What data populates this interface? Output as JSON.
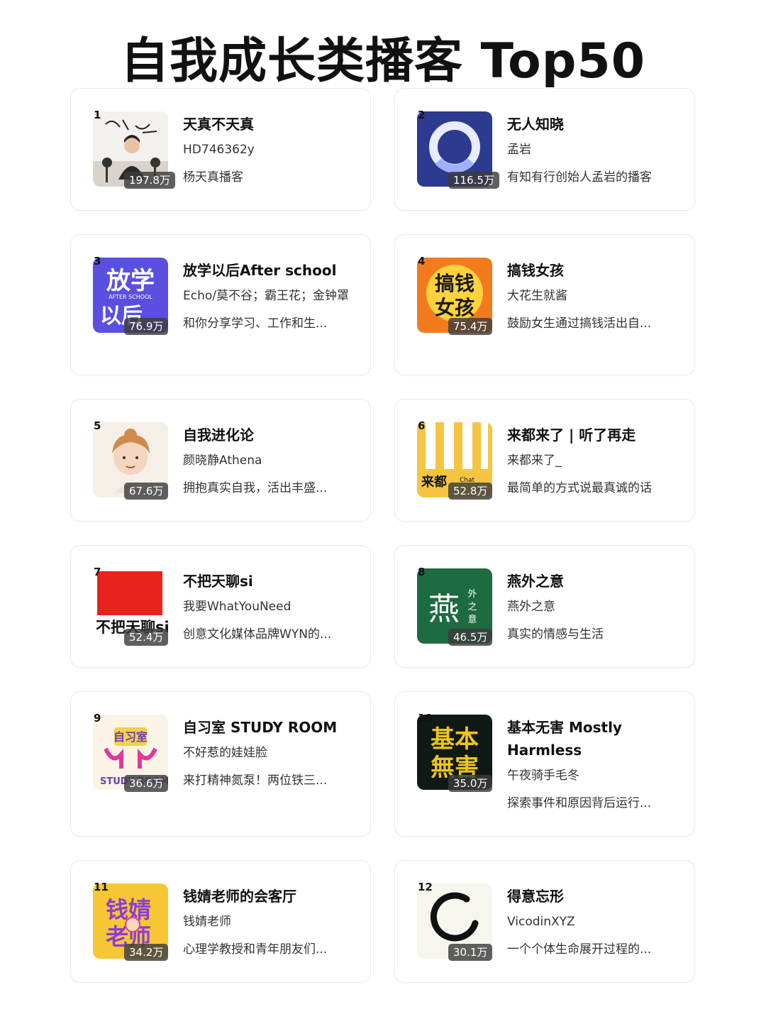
{
  "page": {
    "title": "自我成长类播客 Top50"
  },
  "podcasts": [
    {
      "rank": "1",
      "name": "天真不天真",
      "host": "HD746362y",
      "desc": "杨天真播客",
      "plays": "197.8万"
    },
    {
      "rank": "2",
      "name": "无人知晓",
      "host": "孟岩",
      "desc": "有知有行创始人孟岩的播客",
      "plays": "116.5万"
    },
    {
      "rank": "3",
      "name": "放学以后After school",
      "host": "Echo/莫不谷；霸王花；金钟罩",
      "desc": "和你分享学习、工作和生...",
      "plays": "76.9万",
      "cover_text": [
        "放学",
        "AFTER SCHOOL",
        "以后"
      ]
    },
    {
      "rank": "4",
      "name": "搞钱女孩",
      "host": "大花生就酱",
      "desc": "鼓励女生通过搞钱活出自...",
      "plays": "75.4万",
      "cover_text": [
        "搞钱",
        "女孩"
      ]
    },
    {
      "rank": "5",
      "name": "自我进化论",
      "host": "颜晓静Athena",
      "desc": "拥抱真实自我，活出丰盛...",
      "plays": "67.6万"
    },
    {
      "rank": "6",
      "name": "来都来了 | 听了再走",
      "host": "来都来了_",
      "desc": "最简单的方式说最真诚的话",
      "plays": "52.8万",
      "cover_text": [
        "来都",
        "Chat"
      ]
    },
    {
      "rank": "7",
      "name": "不把天聊si",
      "host": "我要WhatYouNeed",
      "desc": "创意文化媒体品牌WYN的...",
      "plays": "52.4万",
      "cover_text": [
        "不把天聊si"
      ]
    },
    {
      "rank": "8",
      "name": "燕外之意",
      "host": "燕外之意",
      "desc": "真实的情感与生活",
      "plays": "46.5万",
      "cover_text": [
        "燕",
        "外",
        "之",
        "意"
      ]
    },
    {
      "rank": "9",
      "name": "自习室 STUDY ROOM",
      "host": "不好惹的娃娃脸",
      "desc": "来打精神氮泵！两位铁三...",
      "plays": "36.6万",
      "cover_text": [
        "自习室",
        "STUDY ROOM"
      ]
    },
    {
      "rank": "10",
      "name": "基本无害 Mostly Harmless",
      "host": "午夜骑手毛冬",
      "desc": "探索事件和原因背后运行...",
      "plays": "35.0万",
      "cover_text": [
        "基本",
        "無害"
      ]
    },
    {
      "rank": "11",
      "name": "钱婧老师的会客厅",
      "host": "钱婧老师",
      "desc": "心理学教授和青年朋友们...",
      "plays": "34.2万",
      "cover_text": [
        "钱婧",
        "老师"
      ]
    },
    {
      "rank": "12",
      "name": "得意忘形",
      "host": "VicodinXYZ",
      "desc": "一个个体生命展开过程的...",
      "plays": "30.1万"
    }
  ],
  "colors": {
    "cover2_bg": "#2c3a8f",
    "cover3_bg": "#5a4fe0",
    "cover4_bg": "#f47a1e",
    "cover6_bg": "#f5c542",
    "cover7_red": "#e8221d",
    "cover8_bg": "#1d6b40",
    "cover10_bg": "#0f1a16",
    "cover11_bg": "#f6c634"
  }
}
